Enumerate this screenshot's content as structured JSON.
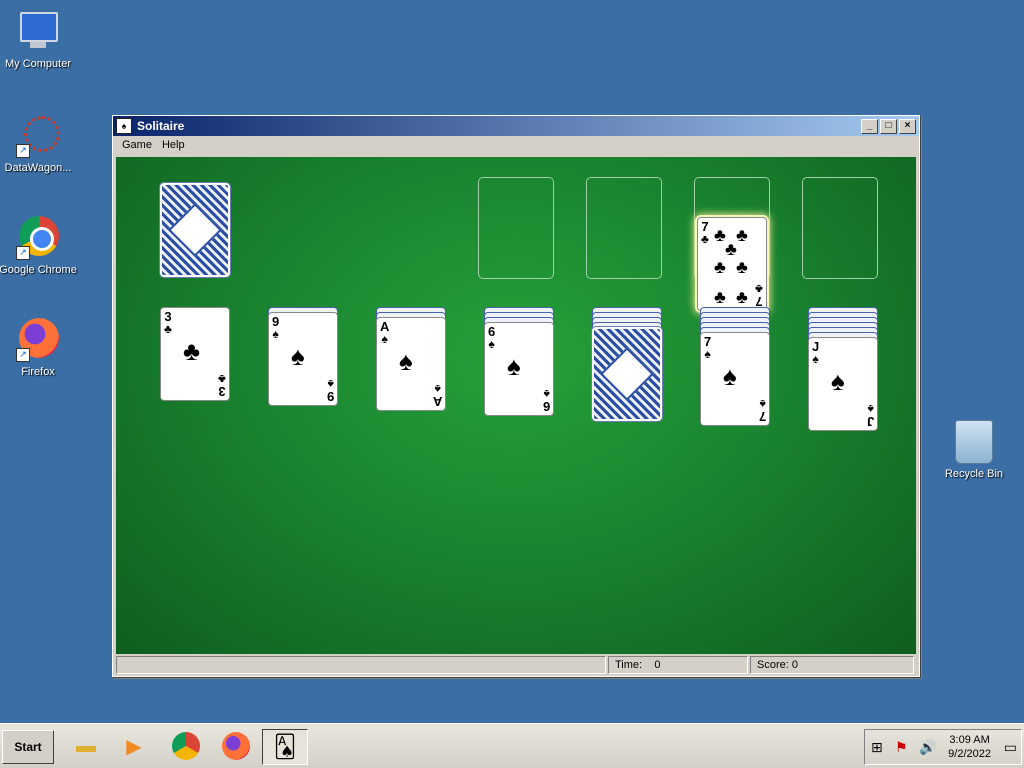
{
  "desktop": {
    "icons": [
      {
        "label": "My Computer"
      },
      {
        "label": "DataWagon..."
      },
      {
        "label": "Google Chrome"
      },
      {
        "label": "Firefox"
      }
    ],
    "recycle_bin": "Recycle Bin"
  },
  "window": {
    "title": "Solitaire",
    "menu": [
      "Game",
      "Help"
    ],
    "status": {
      "time_label": "Time:",
      "time_value": "0",
      "score_label": "Score:",
      "score_value": "0"
    }
  },
  "game": {
    "foundation_card": {
      "rank": "7",
      "suit": "♣"
    },
    "tableau": [
      {
        "rank": "3",
        "suit": "♣",
        "hidden": 0
      },
      {
        "rank": "9",
        "suit": "♠",
        "hidden": 1
      },
      {
        "rank": "A",
        "suit": "♠",
        "hidden": 2
      },
      {
        "rank": "6",
        "suit": "♠",
        "hidden": 3
      },
      {
        "rank": "",
        "suit": "",
        "hidden": 4
      },
      {
        "rank": "7",
        "suit": "♠",
        "hidden": 5
      },
      {
        "rank": "J",
        "suit": "♠",
        "hidden": 6
      }
    ]
  },
  "taskbar": {
    "start_label": "Start",
    "clock_time": "3:09 AM",
    "clock_date": "9/2/2022"
  },
  "colors": {
    "desktop": "#3a6ea5",
    "felt": "#1a8530"
  }
}
